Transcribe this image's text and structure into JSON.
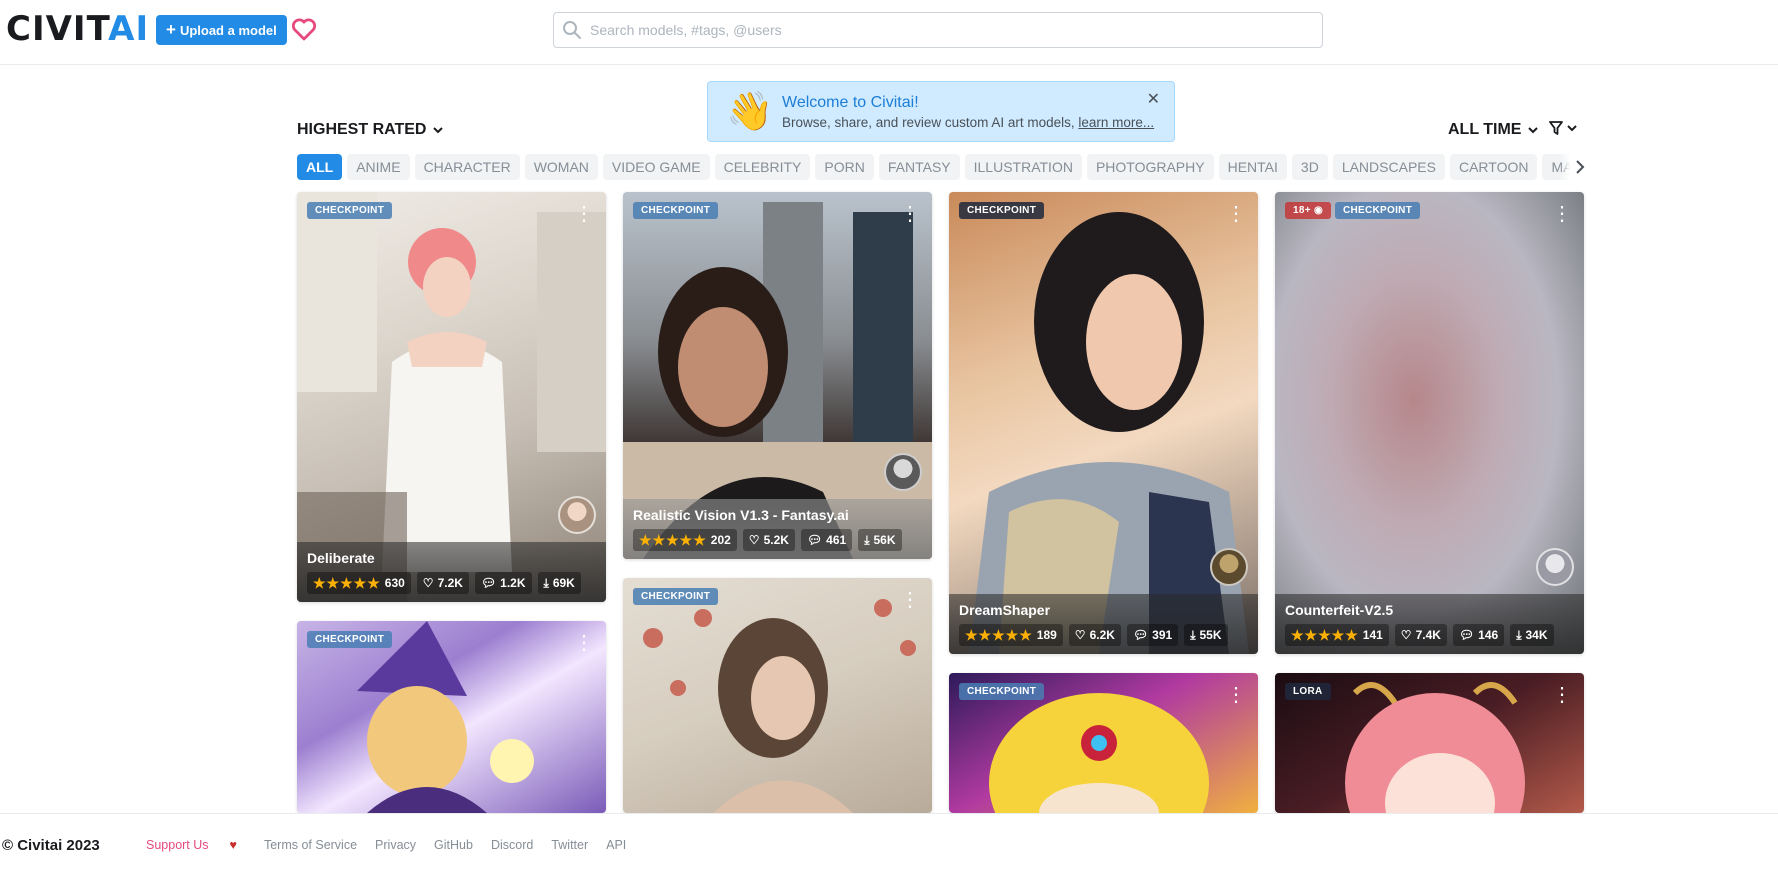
{
  "header": {
    "logo_left": "CIVIT",
    "logo_right": "AI",
    "upload_label": "Upload a model",
    "search_placeholder": "Search models, #tags, @users"
  },
  "welcome": {
    "title": "Welcome to Civitai!",
    "body": "Browse, share, and review custom AI art models,",
    "link": "learn more..."
  },
  "sort": {
    "label": "HIGHEST RATED"
  },
  "period": {
    "label": "ALL TIME"
  },
  "tags": [
    "ALL",
    "ANIME",
    "CHARACTER",
    "WOMAN",
    "VIDEO GAME",
    "CELEBRITY",
    "PORN",
    "FANTASY",
    "ILLUSTRATION",
    "PHOTOGRAPHY",
    "HENTAI",
    "3D",
    "LANDSCAPES",
    "CARTOON",
    "MANGA"
  ],
  "cards": [
    {
      "type": "CHECKPOINT",
      "name": "Deliberate",
      "rating_count": "630",
      "likes": "7.2K",
      "comments": "1.2K",
      "downloads": "69K"
    },
    {
      "type": "CHECKPOINT",
      "name": "Realistic Vision V1.3 - Fantasy.ai",
      "rating_count": "202",
      "likes": "5.2K",
      "comments": "461",
      "downloads": "56K"
    },
    {
      "type": "CHECKPOINT",
      "name": "DreamShaper",
      "rating_count": "189",
      "likes": "6.2K",
      "comments": "391",
      "downloads": "55K"
    },
    {
      "type": "CHECKPOINT",
      "nsfw": "18+",
      "name": "Counterfeit-V2.5",
      "rating_count": "141",
      "likes": "7.4K",
      "comments": "146",
      "downloads": "34K"
    },
    {
      "type": "CHECKPOINT"
    },
    {
      "type": "CHECKPOINT"
    },
    {
      "type": "CHECKPOINT"
    },
    {
      "type": "LORA"
    }
  ],
  "footer": {
    "copyright": "© Civitai 2023",
    "support": "Support Us",
    "terms": "Terms of Service",
    "privacy": "Privacy",
    "github": "GitHub",
    "discord": "Discord",
    "twitter": "Twitter",
    "api": "API"
  },
  "colors": {
    "accent": "#228be6",
    "star": "#fab005",
    "heart": "#e64980"
  }
}
